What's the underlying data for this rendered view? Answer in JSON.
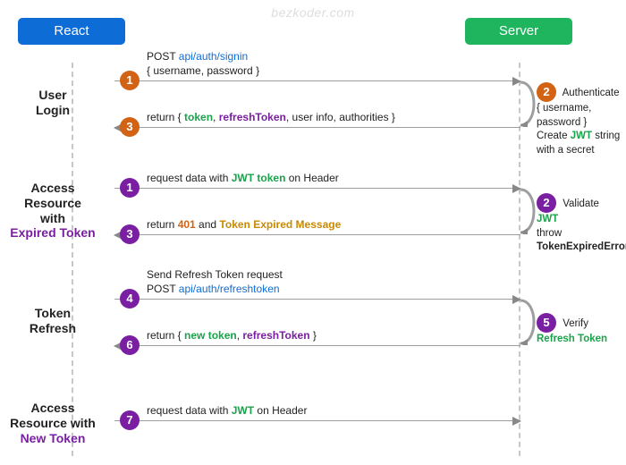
{
  "watermark": "bezkoder.com",
  "lifelines": {
    "client": "React",
    "server": "Server"
  },
  "sections": {
    "login": {
      "l1": "User",
      "l2": "Login"
    },
    "expired": {
      "l1": "Access",
      "l2": "Resource",
      "l3": "with",
      "l4": "Expired Token"
    },
    "refresh": {
      "l1": "Token",
      "l2": "Refresh"
    },
    "new": {
      "l1": "Access",
      "l2": "Resource with",
      "l3": "New Token"
    }
  },
  "msgs": {
    "m1": {
      "n": "1",
      "pre": "POST ",
      "api": "api/auth/signin",
      "body": "{ username, password }"
    },
    "m2": {
      "n": "2",
      "t1": "Authenticate { username, password }",
      "t2a": "Create ",
      "t2b": "JWT",
      "t2c": " string with a secret"
    },
    "m3": {
      "n": "3",
      "pre": "return { ",
      "a": "token",
      "sep1": ", ",
      "b": "refreshToken",
      "rest": ", user info, authorities }"
    },
    "m4": {
      "n": "1",
      "pre": "request data with ",
      "jwt": "JWT token",
      "post": " on Header"
    },
    "m5": {
      "n": "2",
      "t1a": "Validate ",
      "t1b": "JWT",
      "t2a": "throw ",
      "t2b": "TokenExpiredError"
    },
    "m6": {
      "n": "3",
      "pre": "return ",
      "code": "401",
      "mid": " and ",
      "err": "Token Expired Message"
    },
    "m7": {
      "n": "4",
      "l1": "Send Refresh Token request",
      "l2a": "POST ",
      "l2b": "api/auth/refreshtoken"
    },
    "m8": {
      "n": "5",
      "pre": "Verify ",
      "rtk": "Refresh Token"
    },
    "m9": {
      "n": "6",
      "pre": "return { ",
      "a": "new token",
      "sep": ", ",
      "b": "refreshToken",
      "post": " }"
    },
    "m10": {
      "n": "7",
      "pre": "request data with ",
      "jwt": "JWT",
      "post": " on Header"
    }
  }
}
